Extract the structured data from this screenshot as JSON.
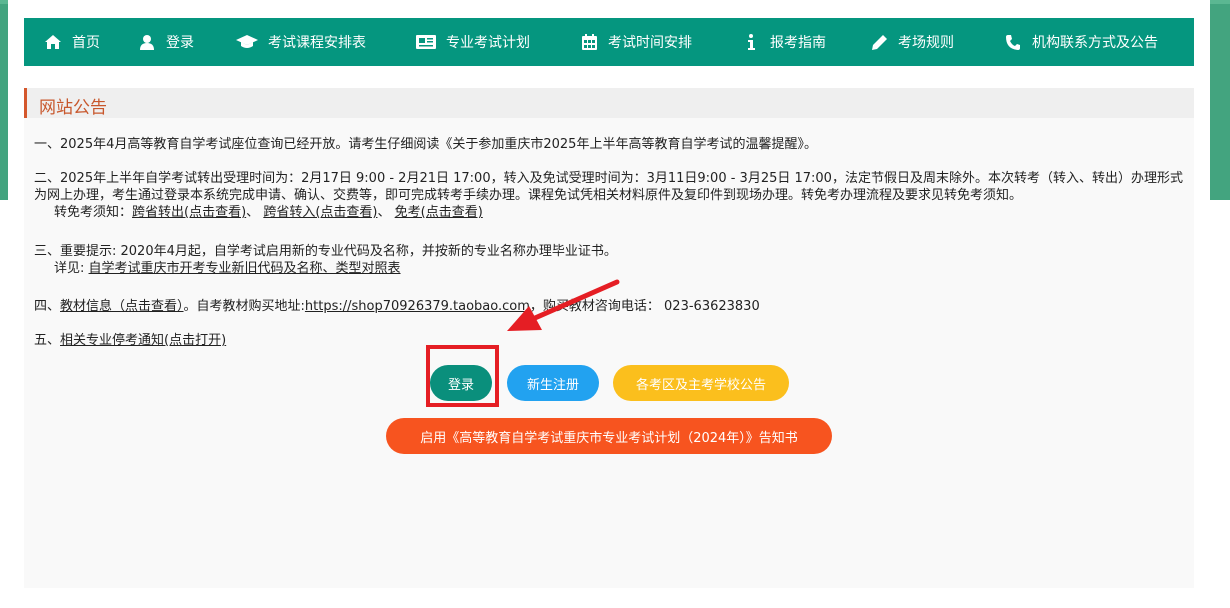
{
  "nav": {
    "items": [
      {
        "label": "首页",
        "icon": "home-icon"
      },
      {
        "label": "登录",
        "icon": "user-icon"
      },
      {
        "label": "考试课程安排表",
        "icon": "graduation-cap-icon"
      },
      {
        "label": "专业考试计划",
        "icon": "newspaper-icon"
      },
      {
        "label": "考试时间安排",
        "icon": "calendar-icon"
      },
      {
        "label": "报考指南",
        "icon": "info-icon"
      },
      {
        "label": "考场规则",
        "icon": "pencil-icon"
      },
      {
        "label": "机构联系方式及公告",
        "icon": "phone-icon"
      }
    ]
  },
  "panel": {
    "title": "网站公告",
    "n1": {
      "text": "一、2025年4月高等教育自学考试座位查询已经开放。请考生仔细阅读《关于参加重庆市2025年上半年高等教育自学考试的温馨提醒》。"
    },
    "n2": {
      "text": "二、2025年上半年自学考试转出受理时间为：2月17日 9:00 - 2月21日 17:00，转入及免试受理时间为：3月11日9:00 - 3月25日 17:00，法定节假日及周末除外。本次转考（转入、转出）办理形式为网上办理，考生通过登录本系统完成申请、确认、交费等，即可完成转考手续办理。课程免试凭相关材料原件及复印件到现场办理。转免考办理流程及要求见转免考须知。",
      "prefix": "转免考须知：",
      "link1": "跨省转出(点击查看)",
      "sep": "、",
      "link2": "跨省转入(点击查看)",
      "link3": "免考(点击查看)"
    },
    "n3": {
      "text": "三、重要提示: 2020年4月起，自学考试启用新的专业代码及名称，并按新的专业名称办理毕业证书。",
      "prefix": "详见: ",
      "link": "自学考试重庆市开考专业新旧代码及名称、类型对照表"
    },
    "n4": {
      "prefix": "四、",
      "link": "教材信息（点击查看）",
      "mid": "。自考教材购买地址:",
      "url": "https://shop70926379.taobao.com",
      "suffix": "，购买教材咨询电话： 023-63623830"
    },
    "n5": {
      "prefix": "五、",
      "link": "相关专业停考通知(点击打开)"
    }
  },
  "buttons": {
    "login": "登录",
    "register": "新生注册",
    "announce": "各考区及主考学校公告",
    "wide": "启用《高等教育自学考试重庆市专业考试计划（2024年）》告知书"
  },
  "colors": {
    "nav": "#05967f",
    "accent_title": "#c8572c",
    "login": "#0a8f7c",
    "register": "#22a2f0",
    "announce": "#fbbf1d",
    "wide": "#f7541f",
    "highlight": "#e51e24"
  }
}
